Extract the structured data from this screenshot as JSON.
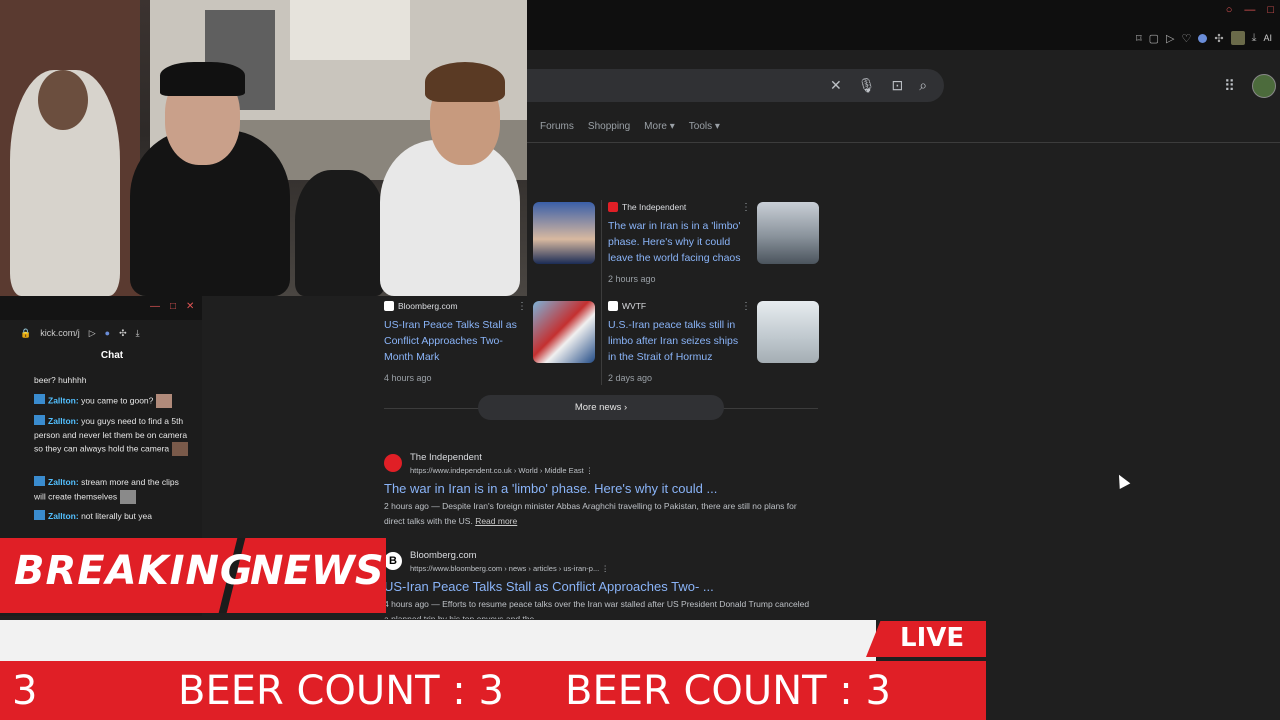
{
  "chat": {
    "url": "kick.com/j",
    "title": "Chat",
    "messages": [
      {
        "name": "",
        "text": "beer? huhhhh"
      },
      {
        "name": "Zallton:",
        "text": "you came to goon?"
      },
      {
        "name": "Zallton:",
        "text": "you guys need to find a 5th person and never let them be on camera so they can always hold the camera"
      },
      {
        "name": "Zallton:",
        "text": "stream more and the clips will create themselves"
      },
      {
        "name": "Zallton:",
        "text": "not literally but yea"
      }
    ]
  },
  "google": {
    "tabs": [
      "Forums",
      "Shopping",
      "More",
      "Tools"
    ],
    "more_news": "More news",
    "news_cards": [
      {
        "source": "The Independent",
        "title": "The war in Iran is in a 'limbo' phase. Here's why it could leave the world facing chaos",
        "time": "2 hours ago",
        "source_color": "#e01f26",
        "thumb": "ship"
      },
      {
        "source": "Bloomberg.com",
        "title": "US-Iran Peace Talks Stall as Conflict Approaches Two-Month Mark",
        "time": "4 hours ago",
        "source_color": "#ffffff",
        "thumb": "flag"
      },
      {
        "source": "WVTF",
        "title": "U.S.-Iran peace talks still in limbo after Iran seizes ships in the Strait of Hormuz",
        "time": "2 days ago",
        "source_color": "#ffffff",
        "thumb": "sea"
      }
    ],
    "results": [
      {
        "site": "The Independent",
        "url": "https://www.independent.co.uk › World › Middle East",
        "title": "The war in Iran is in a 'limbo' phase. Here's why it could ...",
        "snippet_time": "2 hours ago",
        "snippet": "— Despite Iran's foreign minister Abbas Araghchi travelling to Pakistan, there are still no plans for direct talks with the US.",
        "read_more": "Read more"
      },
      {
        "site": "Bloomberg.com",
        "url": "https://www.bloomberg.com › news › articles › us-iran-p...",
        "title": "US-Iran Peace Talks Stall as Conflict Approaches Two- ...",
        "snippet_time": "4 hours ago",
        "snippet": "— Efforts to resume peace talks over the Iran war stalled after US President Donald Trump canceled a planned trip by his top envoys and the ..."
      }
    ]
  },
  "overlay": {
    "breaking": "BREAKING",
    "news": "NEWS",
    "live": "LIVE",
    "ticker_left": "3",
    "ticker_1": "BEER COUNT : 3",
    "ticker_2": "BEER COUNT : 3"
  },
  "toolbar": {
    "ai_label": "AI"
  }
}
